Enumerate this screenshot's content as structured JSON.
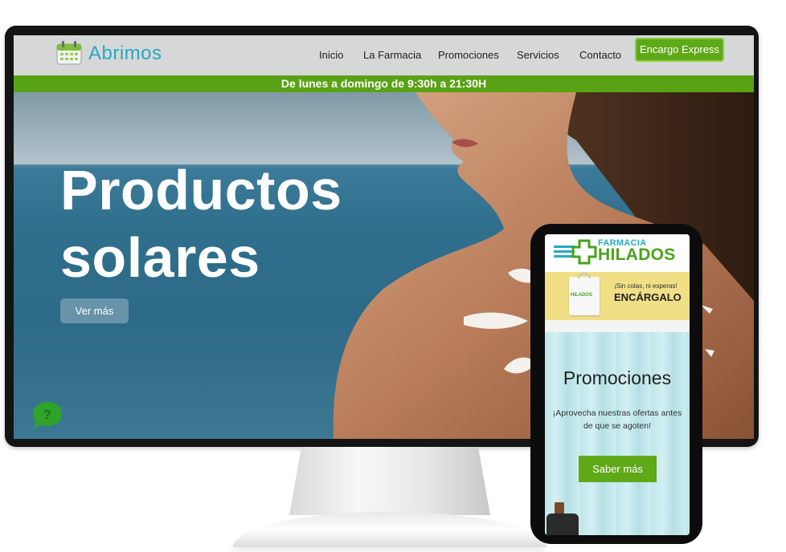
{
  "site": {
    "logo_text": "Abrimos",
    "nav": [
      "Inicio",
      "La Farmacia",
      "Promociones",
      "Servicios",
      "Contacto"
    ],
    "cta": "Encargo Express",
    "hours": "De lunes a domingo  de 9:30h a 21:30H"
  },
  "hero": {
    "title_line1": "Productos",
    "title_line2": "solares",
    "button": "Ver más"
  },
  "mobile": {
    "brand_top": "FARMACIA",
    "brand": "HILADOS",
    "banner_small": "¡Sin colas, ni esperas!",
    "banner_big": "ENCÁRGALO",
    "bag_text": "HILADOS",
    "promo_title": "Promociones",
    "promo_text": "¡Aprovecha nuestras ofertas antes de que se agoten!",
    "promo_button": "Saber más"
  },
  "colors": {
    "brand_green": "#5fa818",
    "brand_blue": "#27a8c6",
    "banner_yellow": "#f1df86"
  },
  "icons": [
    "calendar-icon",
    "chat-help-icon",
    "pharmacy-cross-logo",
    "shopping-bag"
  ]
}
